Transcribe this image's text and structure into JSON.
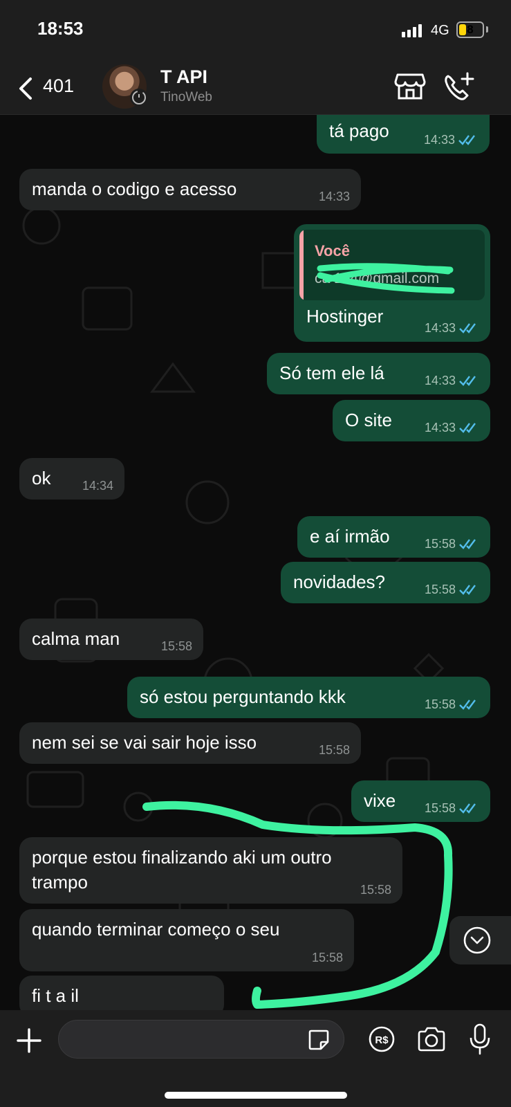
{
  "status": {
    "time": "18:53",
    "network": "4G",
    "battery": "8"
  },
  "header": {
    "back_count": "401",
    "contact_name": "T API",
    "contact_subtitle": "TinoWeb"
  },
  "messages": [
    {
      "direction": "out",
      "text": "tá pago",
      "time": "14:33",
      "read": true
    },
    {
      "direction": "in",
      "text": "manda o codigo e acesso",
      "time": "14:33"
    },
    {
      "direction": "out",
      "quote_author": "Você",
      "quote_text": "ca          194@gmail.com",
      "text": "Hostinger",
      "time": "14:33",
      "read": true
    },
    {
      "direction": "out",
      "text": "Só tem ele lá",
      "time": "14:33",
      "read": true
    },
    {
      "direction": "out",
      "text": "O site",
      "time": "14:33",
      "read": true
    },
    {
      "direction": "in",
      "text": "ok",
      "time": "14:34"
    },
    {
      "direction": "out",
      "text": "e aí irmão",
      "time": "15:58",
      "read": true
    },
    {
      "direction": "out",
      "text": "novidades?",
      "time": "15:58",
      "read": true
    },
    {
      "direction": "in",
      "text": "calma man",
      "time": "15:58"
    },
    {
      "direction": "out",
      "text": "só estou perguntando kkk",
      "time": "15:58",
      "read": true
    },
    {
      "direction": "in",
      "text": "nem sei se vai sair hoje isso",
      "time": "15:58"
    },
    {
      "direction": "out",
      "text": "vixe",
      "time": "15:58",
      "read": true
    },
    {
      "direction": "in",
      "text_line1": "porque estou finalizando aki um outro",
      "text_line2": "trampo",
      "time": "15:58"
    },
    {
      "direction": "in",
      "text": "quando terminar começo o seu",
      "time": "15:58"
    },
    {
      "direction": "in",
      "text": "fi    t    a   il"
    }
  ],
  "composer": {
    "placeholder": ""
  },
  "colors": {
    "outgoing_bubble": "#144d37",
    "incoming_bubble": "#232525",
    "read_ticks": "#53bdeb",
    "quote_author": "#f5a3a7",
    "annotation_marker": "#3ef2a0"
  },
  "icons": [
    "back-chevron-icon",
    "store-icon",
    "add-call-icon",
    "double-check-icon",
    "chevron-down-icon",
    "plus-icon",
    "sticker-icon",
    "pix-payment-icon",
    "camera-icon",
    "microphone-icon"
  ]
}
